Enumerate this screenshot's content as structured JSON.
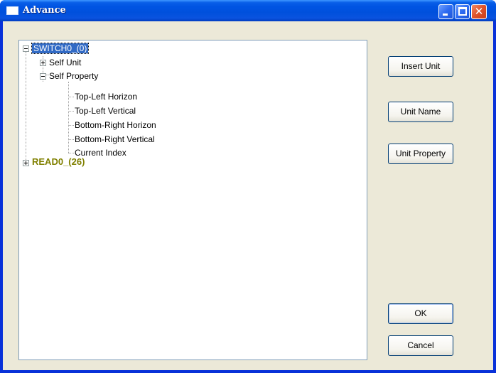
{
  "window": {
    "title": "Advance",
    "controls": {
      "minimize": "minimize",
      "maximize": "maximize",
      "close": "close"
    }
  },
  "tree": {
    "items": [
      {
        "label": "SWITCH0_(0)",
        "expanded": true,
        "selected": true
      },
      {
        "label": "Self Unit",
        "expanded": false
      },
      {
        "label": "Self Property",
        "expanded": true
      },
      {
        "label": "Top-Left Horizon"
      },
      {
        "label": "Top-Left Vertical"
      },
      {
        "label": "Bottom-Right Horizon"
      },
      {
        "label": "Bottom-Right Vertical"
      },
      {
        "label": "Current Index"
      },
      {
        "label": "READ0_(26)",
        "expanded": false,
        "color": "#808000"
      }
    ]
  },
  "buttons": {
    "insert_unit": "Insert Unit",
    "unit_name": "Unit Name",
    "unit_property": "Unit Property",
    "ok": "OK",
    "cancel": "Cancel"
  },
  "colors": {
    "titlebar": "#0054e3",
    "client_bg": "#ece9d8",
    "selection": "#316ac5",
    "olive_text": "#808000"
  }
}
